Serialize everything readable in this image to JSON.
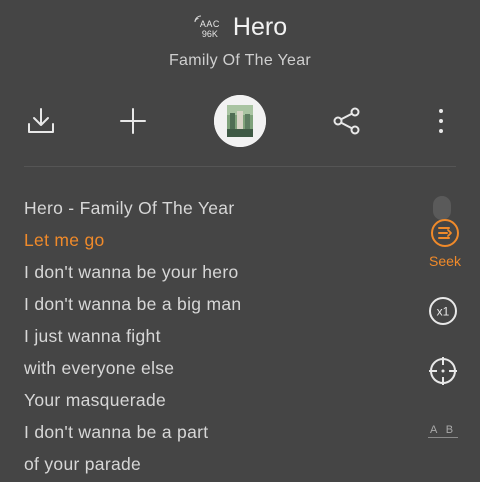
{
  "header": {
    "quality_line1": "AAC",
    "quality_line2": "96K",
    "song_title": "Hero",
    "artist": "Family Of The Year"
  },
  "lyrics": [
    {
      "text": "Hero - Family Of The Year",
      "active": false
    },
    {
      "text": "Let me go",
      "active": true
    },
    {
      "text": "I don't wanna be your hero",
      "active": false
    },
    {
      "text": "I don't wanna be a big man",
      "active": false
    },
    {
      "text": "I just wanna fight",
      "active": false
    },
    {
      "text": "with everyone else",
      "active": false
    },
    {
      "text": "Your masquerade",
      "active": false
    },
    {
      "text": "I don't wanna be a part",
      "active": false
    },
    {
      "text": "of your parade",
      "active": false
    }
  ],
  "side_controls": {
    "seek_label": "Seek",
    "speed_label": "x1",
    "ab_label": "A B"
  },
  "colors": {
    "background": "#454545",
    "accent": "#f08a2a",
    "text": "#d7d7d7"
  }
}
